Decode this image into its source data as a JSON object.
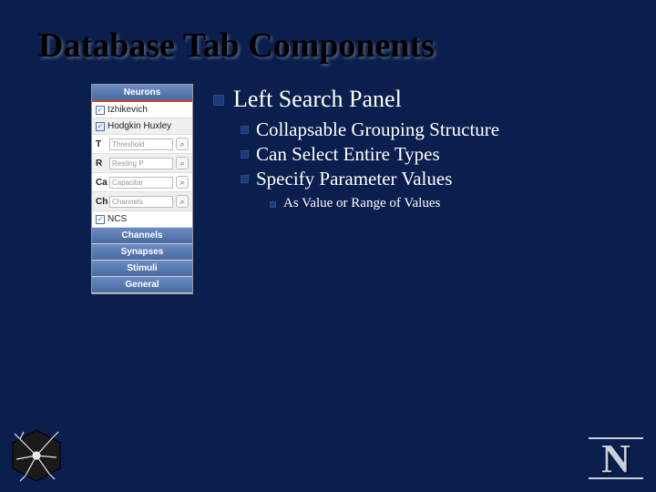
{
  "title": "Database Tab Components",
  "panel": {
    "sections": {
      "neurons": "Neurons",
      "channels": "Channels",
      "synapses": "Synapses",
      "stimuli": "Stimuli",
      "general": "General"
    },
    "items": {
      "izhikevich": "Izhikevich",
      "hodgkin": "Hodgkin Huxley",
      "ncs": "NCS"
    },
    "params": {
      "t_label": "T",
      "t_field": "Threshold",
      "r_label": "R",
      "r_field": "Resting P",
      "ca_label": "Ca",
      "ca_field": "Capacitar",
      "ch_label": "Ch",
      "ch_field": "Channels"
    }
  },
  "bullets": {
    "main": "Left Search Panel",
    "sub1": "Collapsable Grouping Structure",
    "sub2": "Can Select Entire Types",
    "sub3": "Specify Parameter Values",
    "subsub1": "As Value or Range of Values"
  }
}
